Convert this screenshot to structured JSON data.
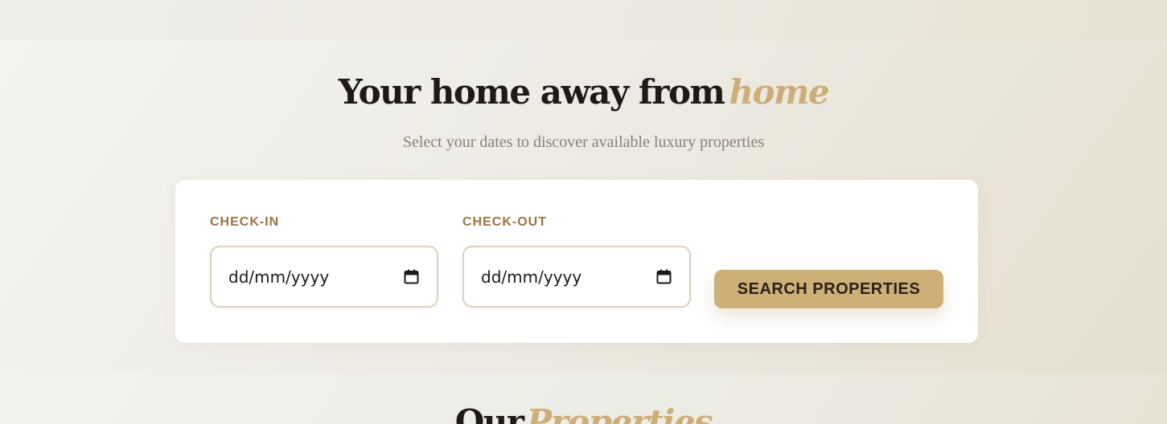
{
  "hero": {
    "title": "Your home away from",
    "title_accent": "home",
    "subtitle": "Select your dates to discover available luxury properties"
  },
  "booking": {
    "checkin_label": "CHECK-IN",
    "checkin_value": "dd/mm/yyyy",
    "checkout_label": "CHECK-OUT",
    "checkout_value": "dd/mm/yyyy",
    "search_label": "SEARCH PROPERTIES"
  },
  "properties": {
    "title": "Our",
    "title_accent": "Properties"
  },
  "icons": {
    "date_picker": "calendar-icon"
  },
  "colors": {
    "accent": "#cdaf78",
    "label": "#9c7444",
    "text": "#1e1b17",
    "subtitle": "#8a8176"
  }
}
